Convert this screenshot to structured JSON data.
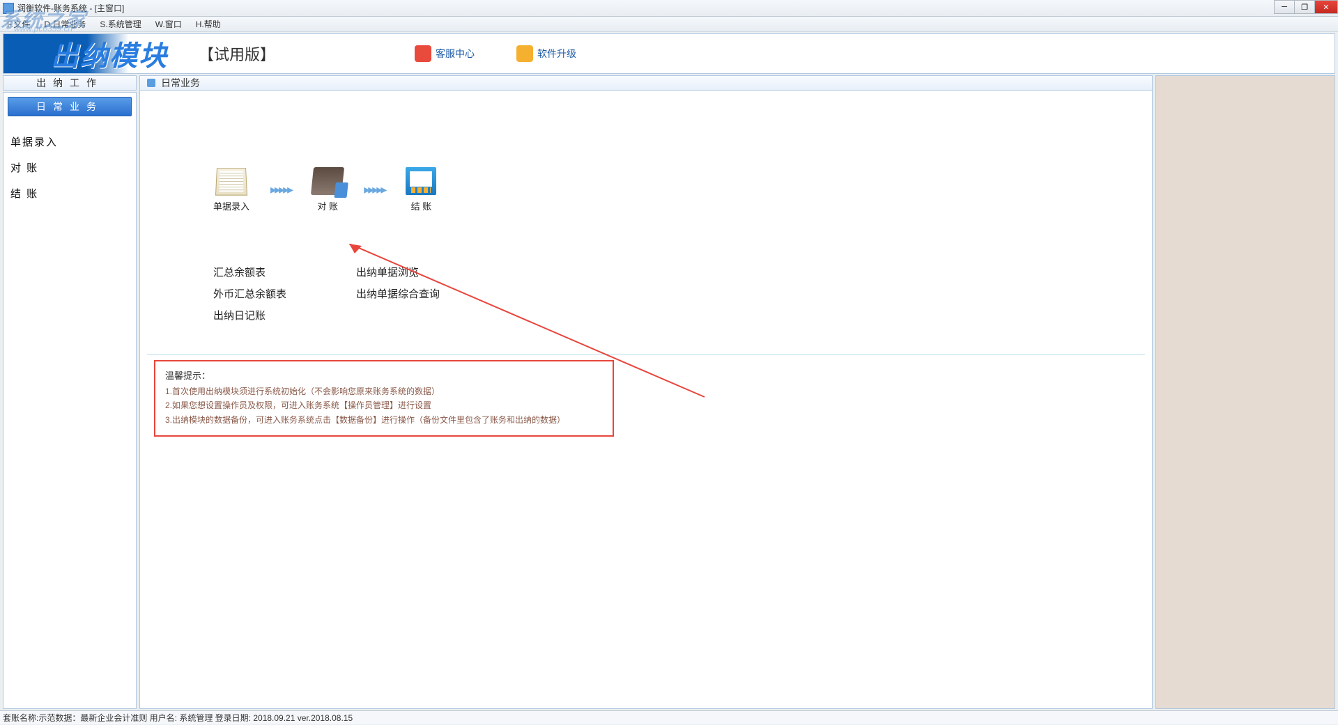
{
  "window": {
    "title": "润衡软件-账务系统 - [主窗口]"
  },
  "menubar": {
    "file": "F.文件",
    "daily": "D.日常业务",
    "system": "S.系统管理",
    "window": "W.窗口",
    "help": "H.帮助"
  },
  "banner": {
    "logo_text": "出纳模块",
    "version": "【试用版】",
    "customer_service": "客服中心",
    "software_upgrade": "软件升级"
  },
  "sidebar": {
    "header": "出纳工作",
    "active_btn": "日常业务",
    "links": {
      "entry": "单据录入",
      "reconcile": "对    账",
      "closing": "结    账"
    }
  },
  "content": {
    "header": "日常业务",
    "workflow": {
      "step1": "单据录入",
      "step2": "对 账",
      "step3": "结 账",
      "arrow": "▸▸▸▸▸"
    },
    "reports": {
      "col1": {
        "r1": "汇总余额表",
        "r2": "外币汇总余额表",
        "r3": "出纳日记账"
      },
      "col2": {
        "r1": "出纳单据浏览",
        "r2": "出纳单据综合查询"
      }
    },
    "hints": {
      "title": "温馨提示：",
      "line1": "1.首次使用出纳模块须进行系统初始化（不会影响您原来账务系统的数据）",
      "line2": "2.如果您想设置操作员及权限，可进入账务系统【操作员管理】进行设置",
      "line3": "3.出纳模块的数据备份，可进入账务系统点击【数据备份】进行操作（备份文件里包含了账务和出纳的数据）"
    }
  },
  "statusbar": {
    "text": "套账名称:示范数据：最新企业会计准则    用户名: 系统管理    登录日期: 2018.09.21  ver.2018.08.15"
  },
  "watermark": {
    "text": "系统之家",
    "url": "www.pc0359.cn"
  }
}
